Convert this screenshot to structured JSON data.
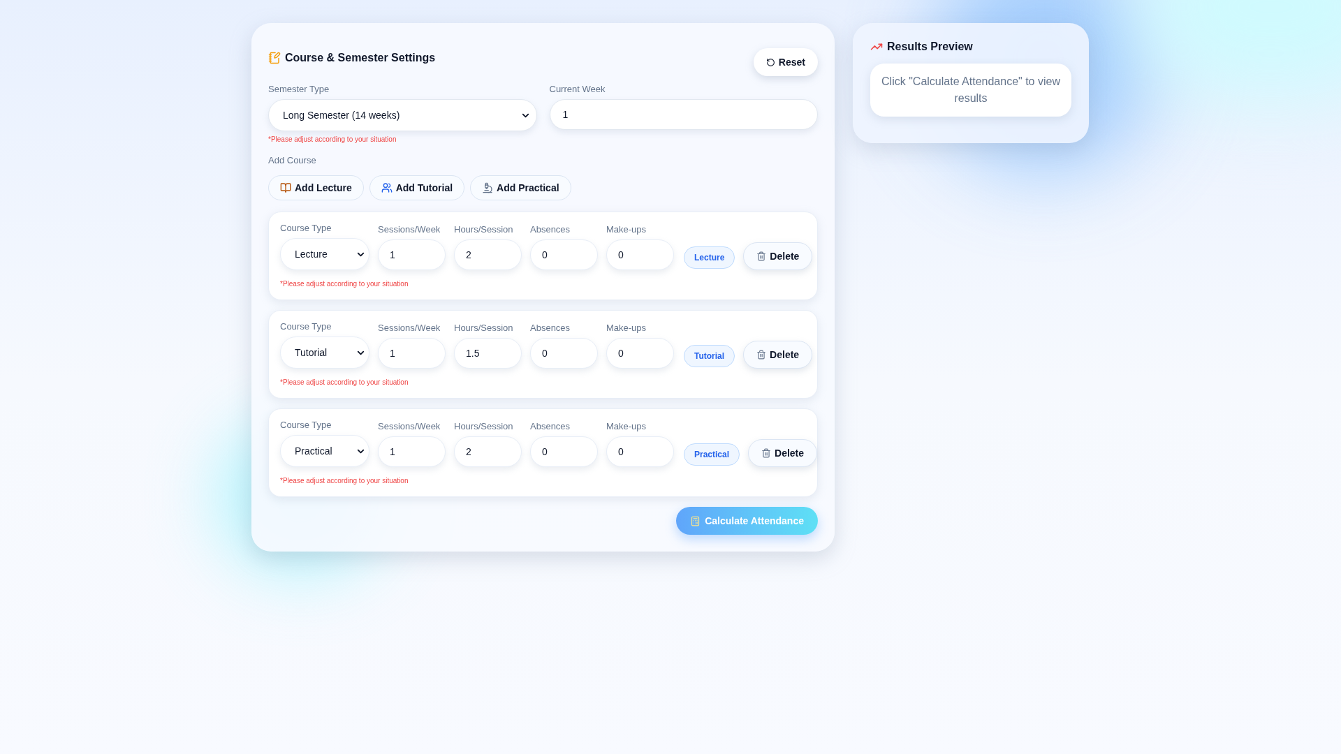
{
  "settings": {
    "title": "Course & Semester Settings",
    "reset_button": "Reset",
    "semester_type": {
      "label": "Semester Type",
      "value": "Long Semester (14 weeks)",
      "note": "*Please adjust according to your situation"
    },
    "current_week": {
      "label": "Current Week",
      "value": "1"
    },
    "add_course": {
      "label": "Add Course",
      "buttons": [
        {
          "kind": "lecture",
          "label": "Add Lecture"
        },
        {
          "kind": "tutorial",
          "label": "Add Tutorial"
        },
        {
          "kind": "practical",
          "label": "Add Practical"
        }
      ]
    },
    "courses": [
      {
        "type_label": "Course Type",
        "type_value": "Lecture",
        "fields": [
          {
            "label": "Sessions/Week",
            "value": "1"
          },
          {
            "label": "Hours/Session",
            "value": "2"
          },
          {
            "label": "Absences",
            "value": "0"
          },
          {
            "label": "Make-ups",
            "value": "0"
          }
        ],
        "badge": "Lecture",
        "delete_button": "Delete",
        "note": "*Please adjust according to your situation"
      },
      {
        "type_label": "Course Type",
        "type_value": "Tutorial",
        "fields": [
          {
            "label": "Sessions/Week",
            "value": "1"
          },
          {
            "label": "Hours/Session",
            "value": "1.5"
          },
          {
            "label": "Absences",
            "value": "0"
          },
          {
            "label": "Make-ups",
            "value": "0"
          }
        ],
        "badge": "Tutorial",
        "delete_button": "Delete",
        "note": "*Please adjust according to your situation"
      },
      {
        "type_label": "Course Type",
        "type_value": "Practical",
        "fields": [
          {
            "label": "Sessions/Week",
            "value": "1"
          },
          {
            "label": "Hours/Session",
            "value": "2"
          },
          {
            "label": "Absences",
            "value": "0"
          },
          {
            "label": "Make-ups",
            "value": "0"
          }
        ],
        "badge": "Practical",
        "delete_button": "Delete",
        "note": "*Please adjust according to your situation"
      }
    ],
    "calculate_button": "Calculate Attendance"
  },
  "results": {
    "title": "Results Preview",
    "message": "Click \"Calculate Attendance\" to view results"
  }
}
